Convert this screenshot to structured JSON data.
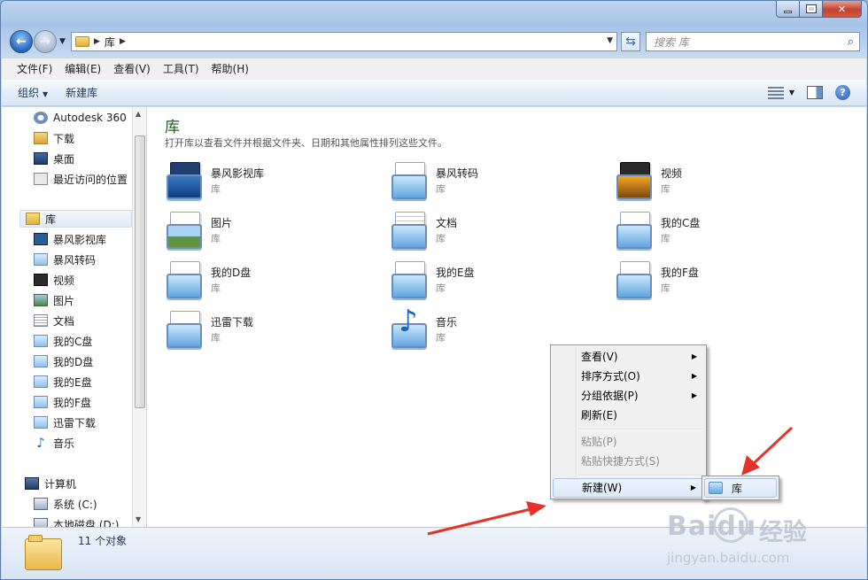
{
  "address": {
    "crumb": "库",
    "search_placeholder": "搜索 库"
  },
  "menubar": [
    "文件(F)",
    "编辑(E)",
    "查看(V)",
    "工具(T)",
    "帮助(H)"
  ],
  "toolbar": {
    "organize": "组织",
    "new_library": "新建库"
  },
  "nav": {
    "favorites": [
      "Autodesk 360",
      "下载",
      "桌面",
      "最近访问的位置"
    ],
    "libraries_header": "库",
    "libraries": [
      "暴风影视库",
      "暴风转码",
      "视频",
      "图片",
      "文档",
      "我的C盘",
      "我的D盘",
      "我的E盘",
      "我的F盘",
      "迅雷下载",
      "音乐"
    ],
    "computer_header": "计算机",
    "drives": [
      "系统 (C:)",
      "本地磁盘 (D:)"
    ]
  },
  "content": {
    "title": "库",
    "description": "打开库以查看文件并根据文件夹、日期和其他属性排列这些文件。",
    "items": [
      {
        "name": "暴风影视库",
        "type": "库",
        "icon": "video-library-icon"
      },
      {
        "name": "暴风转码",
        "type": "库",
        "icon": "library-icon"
      },
      {
        "name": "视频",
        "type": "库",
        "icon": "video-library-icon"
      },
      {
        "name": "图片",
        "type": "库",
        "icon": "pictures-library-icon"
      },
      {
        "name": "文档",
        "type": "库",
        "icon": "documents-library-icon"
      },
      {
        "name": "我的C盘",
        "type": "库",
        "icon": "library-icon"
      },
      {
        "name": "我的D盘",
        "type": "库",
        "icon": "library-icon"
      },
      {
        "name": "我的E盘",
        "type": "库",
        "icon": "library-icon"
      },
      {
        "name": "我的F盘",
        "type": "库",
        "icon": "library-icon"
      },
      {
        "name": "迅雷下载",
        "type": "库",
        "icon": "library-icon"
      },
      {
        "name": "音乐",
        "type": "库",
        "icon": "music-library-icon"
      }
    ]
  },
  "status": {
    "count": "11 个对象"
  },
  "context_menu": {
    "view": "查看(V)",
    "sort": "排序方式(O)",
    "group": "分组依据(P)",
    "refresh": "刷新(E)",
    "paste": "粘贴(P)",
    "paste_shortcut": "粘贴快捷方式(S)",
    "new": "新建(W)",
    "submenu_library": "库"
  },
  "watermark": {
    "brand": "Baidu",
    "cn": "经验",
    "url": "jingyan.baidu.com"
  },
  "colors": {
    "accent": "#1e5a1e",
    "arrow": "#e8312a"
  }
}
